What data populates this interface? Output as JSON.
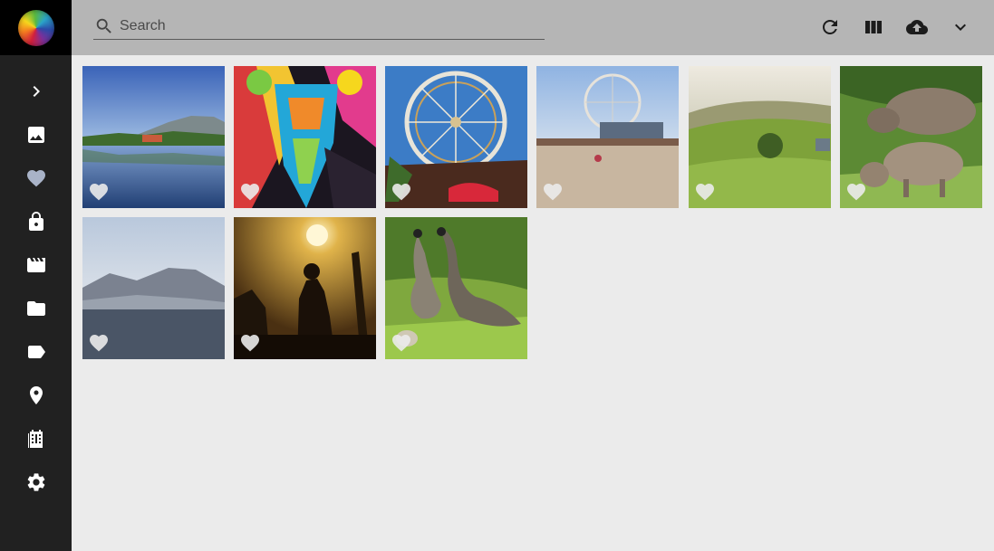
{
  "app": {
    "logo": "rainbow-sphere-logo"
  },
  "sidebar": {
    "items": [
      {
        "name": "expand",
        "icon": "chevron-right-icon"
      },
      {
        "name": "photos",
        "icon": "image-icon"
      },
      {
        "name": "favorites",
        "icon": "heart-icon"
      },
      {
        "name": "private",
        "icon": "lock-icon"
      },
      {
        "name": "videos",
        "icon": "movie-icon"
      },
      {
        "name": "folders",
        "icon": "folder-icon"
      },
      {
        "name": "labels",
        "icon": "label-icon"
      },
      {
        "name": "places",
        "icon": "place-icon"
      },
      {
        "name": "library",
        "icon": "film-library-icon"
      },
      {
        "name": "settings",
        "icon": "gear-icon"
      }
    ]
  },
  "search": {
    "placeholder": "Search",
    "value": ""
  },
  "toolbar": {
    "actions": [
      "refresh-icon",
      "view-column-icon",
      "cloud-upload-icon",
      "chevron-down-icon"
    ]
  },
  "photos": [
    {
      "subject": "lake-reflection",
      "favorite": false
    },
    {
      "subject": "psychedelic-mural",
      "favorite": false
    },
    {
      "subject": "ferris-wheel-fair",
      "favorite": false
    },
    {
      "subject": "pier-ferris-wheel-beach",
      "favorite": false
    },
    {
      "subject": "green-hills",
      "favorite": false
    },
    {
      "subject": "warthogs",
      "favorite": false
    },
    {
      "subject": "misty-mountains-sea",
      "favorite": false
    },
    {
      "subject": "sunset-silhouettes",
      "favorite": false
    },
    {
      "subject": "geese-on-grass",
      "favorite": false
    }
  ],
  "colors": {
    "sidebar": "#212121",
    "topbar": "#b5b5b5",
    "background": "#ebebeb",
    "favorite_icon": "#a9b3c8"
  }
}
